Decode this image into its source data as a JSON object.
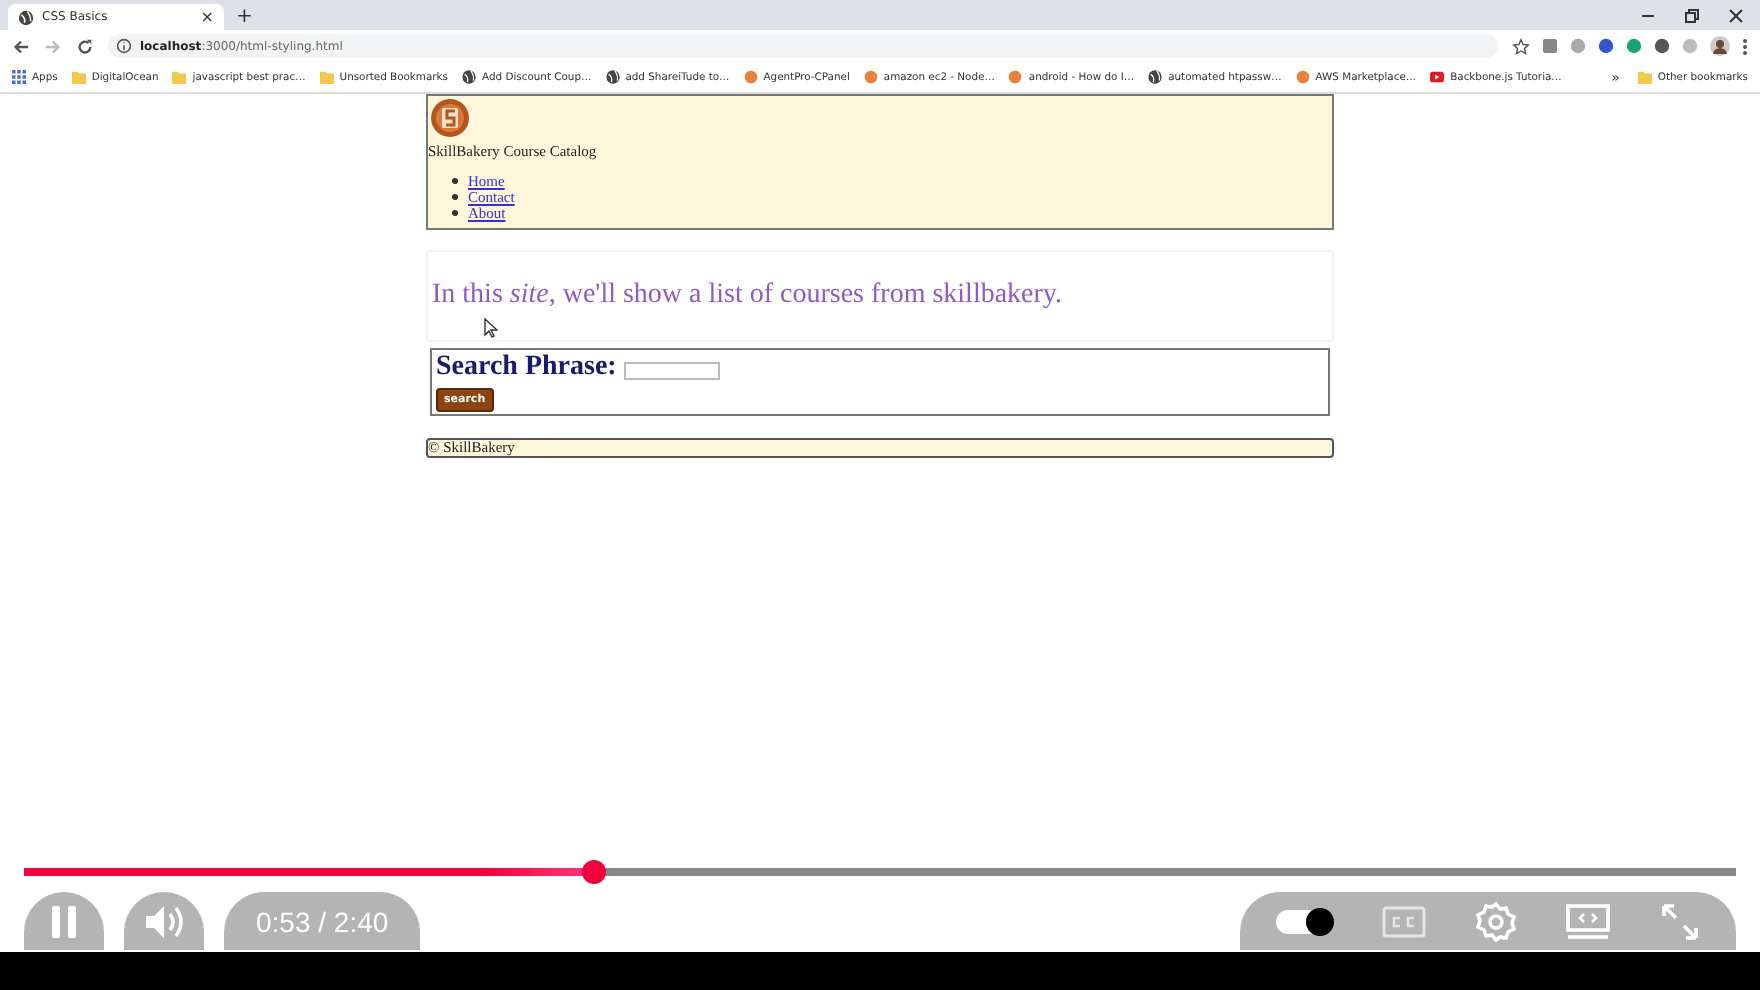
{
  "browser": {
    "tab": {
      "title": "CSS Basics",
      "close": "×"
    },
    "new_tab": "+",
    "url": {
      "host": "localhost",
      "path": ":3000/html-styling.html"
    },
    "bookmarks": [
      {
        "label": "Apps",
        "kind": "apps"
      },
      {
        "label": "DigitalOcean",
        "kind": "folder"
      },
      {
        "label": "javascript best prac…",
        "kind": "folder"
      },
      {
        "label": "Unsorted Bookmarks",
        "kind": "folder"
      },
      {
        "label": "Add Discount Coup…",
        "kind": "globe"
      },
      {
        "label": "add ShareiTude to…",
        "kind": "globe"
      },
      {
        "label": "AgentPro-CPanel",
        "kind": "site"
      },
      {
        "label": "amazon ec2 - Node…",
        "kind": "site"
      },
      {
        "label": "android - How do I…",
        "kind": "site"
      },
      {
        "label": "automated htpassw…",
        "kind": "globe"
      },
      {
        "label": "AWS Marketplace…",
        "kind": "site"
      },
      {
        "label": "Backbone.js Tutoria…",
        "kind": "video"
      }
    ],
    "overflow": "»",
    "other_bookmarks": "Other bookmarks"
  },
  "page": {
    "header": {
      "title": "SkillBakery Course Catalog",
      "nav": [
        "Home",
        "Contact",
        "About"
      ]
    },
    "intro": "In this *site*, we'll show a list of courses from skillbakery.",
    "search": {
      "label": "Search Phrase:",
      "button": "search"
    },
    "footer": "© SkillBakery"
  },
  "player": {
    "progress": {
      "level": 0.333
    },
    "playing": true,
    "time": "0:53 / 2:40",
    "autoplay": true
  }
}
